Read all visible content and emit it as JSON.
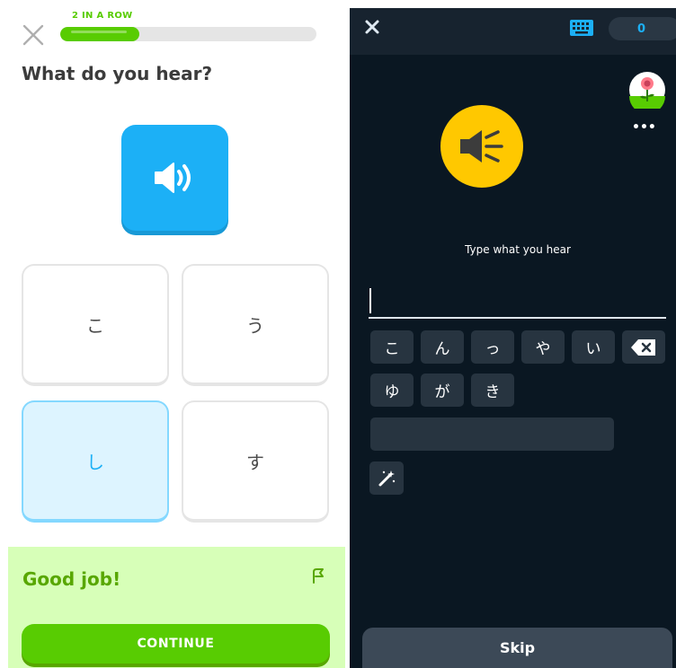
{
  "left": {
    "streak_label": "2 IN A ROW",
    "progress": 0.31,
    "question": "What do you hear?",
    "choices": [
      {
        "label": "こ"
      },
      {
        "label": "う"
      },
      {
        "label": "し"
      },
      {
        "label": "す"
      }
    ],
    "selected_index": 2,
    "feedback": {
      "title": "Good job!",
      "continue_label": "CONTINUE"
    },
    "colors": {
      "accent_green": "#58cc02",
      "accent_blue": "#1cb0f6",
      "feedback_bg": "#d7ffb8"
    }
  },
  "right": {
    "score": "0",
    "prompt": "Type what you hear",
    "answer_value": "",
    "keys_row1": [
      "こ",
      "ん",
      "っ",
      "や",
      "い"
    ],
    "keys_row2": [
      "ゆ",
      "が",
      "き"
    ],
    "skip_label": "Skip",
    "icons": [
      "close-icon",
      "keyboard-icon",
      "avatar-flower-icon",
      "more-icon",
      "speaker-icon",
      "backspace-icon",
      "magic-wand-icon"
    ],
    "colors": {
      "bg": "#0a1722",
      "speaker": "#ffc800",
      "key_bg": "#273440"
    }
  }
}
